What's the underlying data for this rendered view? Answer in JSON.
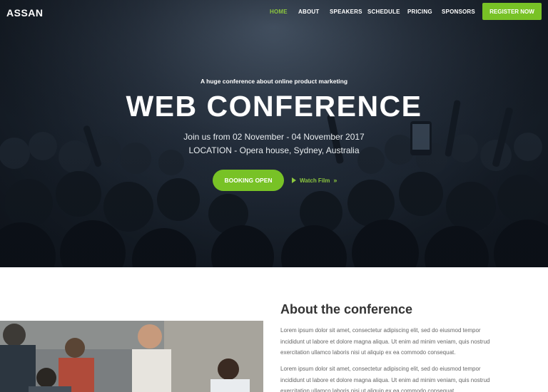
{
  "brand": {
    "logo": "ASSAN"
  },
  "nav": {
    "items": [
      {
        "label": "HOME",
        "active": true
      },
      {
        "label": "ABOUT",
        "active": false
      },
      {
        "label": "SPEAKERS",
        "active": false
      },
      {
        "label": "SCHEDULE",
        "active": false
      },
      {
        "label": "PRICING",
        "active": false
      },
      {
        "label": "SPONSORS",
        "active": false
      }
    ],
    "register_label": "REGISTER NOW"
  },
  "hero": {
    "tagline": "A huge conference about online product marketing",
    "title": "WEB CONFERENCE",
    "dates": "Join us from 02 November - 04 November 2017",
    "location": "LOCATION - Opera house, Sydney, Australia",
    "booking_label": "BOOKING OPEN",
    "watch_label": "Watch Film"
  },
  "about": {
    "title": "About the conference",
    "paragraphs": [
      "Lorem ipsum dolor sit amet, consectetur adipiscing elit, sed do eiusmod tempor incididunt ut labore et dolore magna aliqua. Ut enim ad minim veniam, quis nostrud exercitation ullamco laboris nisi ut aliquip ex ea commodo consequat.",
      "Lorem ipsum dolor sit amet, consectetur adipiscing elit, sed do eiusmod tempor incididunt ut labore et dolore magna aliqua. Ut enim ad minim veniam, quis nostrud exercitation ullamco laboris nisi ut aliquip ex ea commodo consequat."
    ]
  },
  "colors": {
    "accent": "#78c226",
    "accent_text": "#8cc63f",
    "hero_dark": "#171f29"
  },
  "icons": {
    "play": "play-icon",
    "chevron": "double-chevron-right-icon"
  }
}
